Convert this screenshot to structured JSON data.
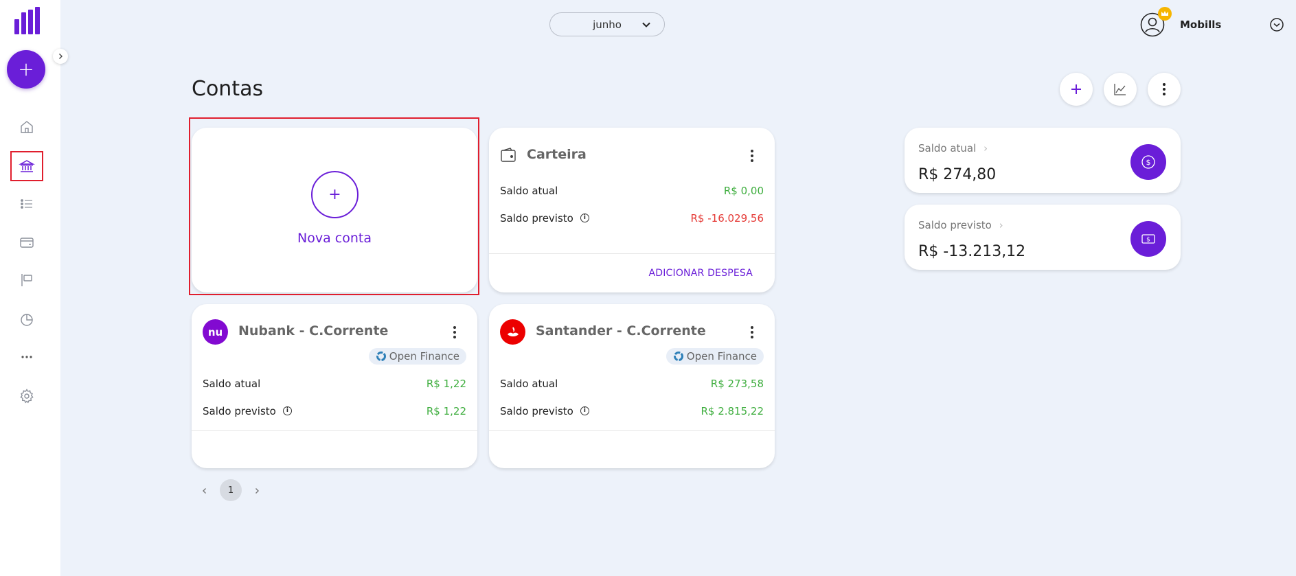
{
  "topbar": {
    "month": "junho",
    "user_name": "Mobills"
  },
  "page": {
    "title": "Contas"
  },
  "new_account": {
    "label": "Nova conta"
  },
  "accounts": [
    {
      "name": "Carteira",
      "saldo_atual_label": "Saldo atual",
      "saldo_atual": "R$ 0,00",
      "saldo_previsto_label": "Saldo previsto",
      "saldo_previsto": "R$ -16.029,56",
      "footer_action": "ADICIONAR DESPESA"
    },
    {
      "name": "Nubank - C.Corrente",
      "logo_text": "nu",
      "badge": "Open Finance",
      "saldo_atual_label": "Saldo atual",
      "saldo_atual": "R$ 1,22",
      "saldo_previsto_label": "Saldo previsto",
      "saldo_previsto": "R$ 1,22"
    },
    {
      "name": "Santander - C.Corrente",
      "badge": "Open Finance",
      "saldo_atual_label": "Saldo atual",
      "saldo_atual": "R$ 273,58",
      "saldo_previsto_label": "Saldo previsto",
      "saldo_previsto": "R$ 2.815,22"
    }
  ],
  "summary": {
    "saldo_atual_label": "Saldo atual",
    "saldo_atual": "R$ 274,80",
    "saldo_previsto_label": "Saldo previsto",
    "saldo_previsto": "R$ -13.213,12"
  },
  "pagination": {
    "current_page": "1"
  },
  "icons": {
    "sidebar": [
      "home-icon",
      "bank-icon",
      "list-icon",
      "card-icon",
      "flag-icon",
      "pie-chart-icon",
      "more-icon",
      "gear-icon"
    ],
    "header_actions": [
      "plus-icon",
      "line-chart-icon",
      "kebab-icon"
    ]
  },
  "colors": {
    "accent": "#6a1ed8",
    "positive": "#3fae3f",
    "negative": "#e53935",
    "background": "#edf2fa",
    "highlight": "#e01e2d",
    "nubank": "#820ad1",
    "santander": "#ec0000"
  }
}
